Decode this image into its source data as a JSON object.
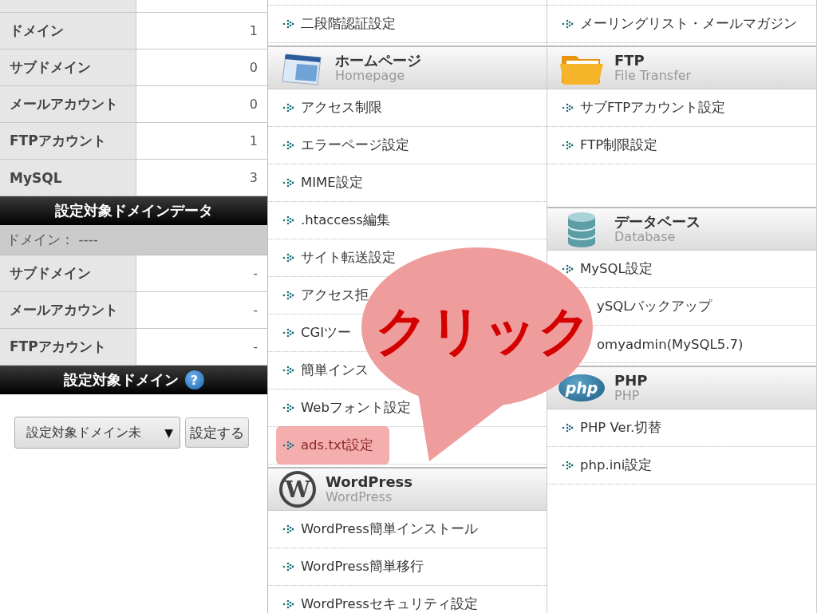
{
  "account_data": {
    "rows": [
      {
        "label": "ドメイン",
        "value": "1"
      },
      {
        "label": "サブドメイン",
        "value": "0"
      },
      {
        "label": "メールアカウント",
        "value": "0"
      },
      {
        "label": "FTPアカウント",
        "value": "1"
      },
      {
        "label": "MySQL",
        "value": "3"
      }
    ]
  },
  "target_domain_data": {
    "title": "設定対象ドメインデータ",
    "domain_line": "ドメイン： ----",
    "rows": [
      {
        "label": "サブドメイン",
        "value": "-"
      },
      {
        "label": "メールアカウント",
        "value": "-"
      },
      {
        "label": "FTPアカウント",
        "value": "-"
      }
    ]
  },
  "target_domain": {
    "title": "設定対象ドメイン",
    "help": "?",
    "select_value": "設定対象ドメイン未",
    "caret": "▼",
    "button": "設定する"
  },
  "menu_columns": [
    [
      {
        "kind": "link",
        "label": "二段階認証設定",
        "arrow": true,
        "highlighted": false
      },
      {
        "kind": "header",
        "title": "ホームページ",
        "subtitle": "Homepage"
      },
      {
        "kind": "link",
        "label": "アクセス制限",
        "arrow": true,
        "highlighted": false
      },
      {
        "kind": "link",
        "label": "エラーページ設定",
        "arrow": true,
        "highlighted": false
      },
      {
        "kind": "link",
        "label": "MIME設定",
        "arrow": true,
        "highlighted": false
      },
      {
        "kind": "link",
        "label": ".htaccess編集",
        "arrow": true,
        "highlighted": false
      },
      {
        "kind": "link",
        "label": "サイト転送設定",
        "arrow": true,
        "highlighted": false
      },
      {
        "kind": "link",
        "label": "アクセス拒",
        "arrow": true,
        "highlighted": false
      },
      {
        "kind": "link",
        "label": "CGIツー",
        "arrow": true,
        "highlighted": false
      },
      {
        "kind": "link",
        "label": "簡単インス",
        "arrow": true,
        "highlighted": false
      },
      {
        "kind": "link",
        "label": "Webフォント設定",
        "arrow": true,
        "highlighted": false
      },
      {
        "kind": "link",
        "label": "ads.txt設定",
        "arrow": true,
        "highlighted": true
      },
      {
        "kind": "header",
        "logo": "W",
        "title": "WordPress",
        "subtitle": "WordPress"
      },
      {
        "kind": "link",
        "label": "WordPress簡単インストール",
        "arrow": true,
        "highlighted": false
      },
      {
        "kind": "link",
        "label": "WordPress簡単移行",
        "arrow": true,
        "highlighted": false
      },
      {
        "kind": "link",
        "label": "WordPressセキュリティ設定",
        "arrow": true,
        "highlighted": false
      }
    ],
    [
      {
        "kind": "link",
        "label": "メーリングリスト・メールマガジン",
        "arrow": true,
        "highlighted": false
      },
      {
        "kind": "header",
        "title": "FTP",
        "subtitle": "File Transfer"
      },
      {
        "kind": "link",
        "label": "サブFTPアカウント設定",
        "arrow": true,
        "highlighted": false
      },
      {
        "kind": "link",
        "label": "FTP制限設定",
        "arrow": true,
        "highlighted": false
      },
      {
        "kind": "spacer"
      },
      {
        "kind": "header",
        "title": "データベース",
        "subtitle": "Database"
      },
      {
        "kind": "link",
        "label": "MySQL設定",
        "arrow": true,
        "highlighted": false
      },
      {
        "kind": "link",
        "label": "ySQLバックアップ",
        "arrow": false,
        "highlighted": false
      },
      {
        "kind": "link",
        "label": "omyadmin(MySQL5.7)",
        "arrow": false,
        "highlighted": false
      },
      {
        "kind": "header",
        "logo": "php",
        "title": "PHP",
        "subtitle": "PHP"
      },
      {
        "kind": "link",
        "label": "PHP Ver.切替",
        "arrow": true,
        "highlighted": false
      },
      {
        "kind": "link",
        "label": "php.ini設定",
        "arrow": true,
        "highlighted": false
      }
    ]
  ],
  "callout": {
    "text": "クリック"
  }
}
